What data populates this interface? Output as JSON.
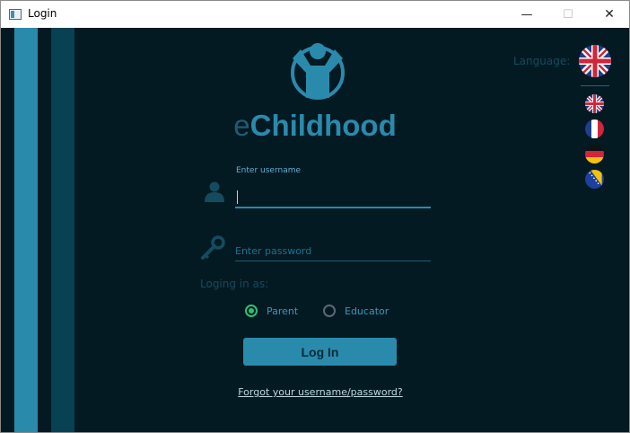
{
  "window": {
    "title": "Login",
    "controls": [
      "minimize",
      "maximize",
      "close"
    ],
    "minimize_glyph": "—",
    "maximize_glyph": "☐",
    "close_glyph": "✕"
  },
  "brand": {
    "prefix": "e",
    "name": "Childhood"
  },
  "login_form": {
    "username_label": "Enter username",
    "username_value": "",
    "password_placeholder": "Enter password",
    "role_label": "Loging in as:",
    "roles": [
      {
        "label": "Parent",
        "selected": true
      },
      {
        "label": "Educator",
        "selected": false
      }
    ],
    "login_button": "Log In",
    "forgot_link": "Forgot your username/password?"
  },
  "language": {
    "label": "Language:",
    "current": "english-flag-icon",
    "options": [
      "english-flag-icon",
      "french-flag-icon",
      "german-flag-icon",
      "bosnian-flag-icon"
    ]
  },
  "colors": {
    "background": "#031a22",
    "accent": "#2a8aac",
    "accent_dark": "#074152",
    "radio_selected": "#2fbf71"
  },
  "icons": [
    "app-window-icon",
    "child-logo-icon",
    "user-icon",
    "key-icon"
  ]
}
